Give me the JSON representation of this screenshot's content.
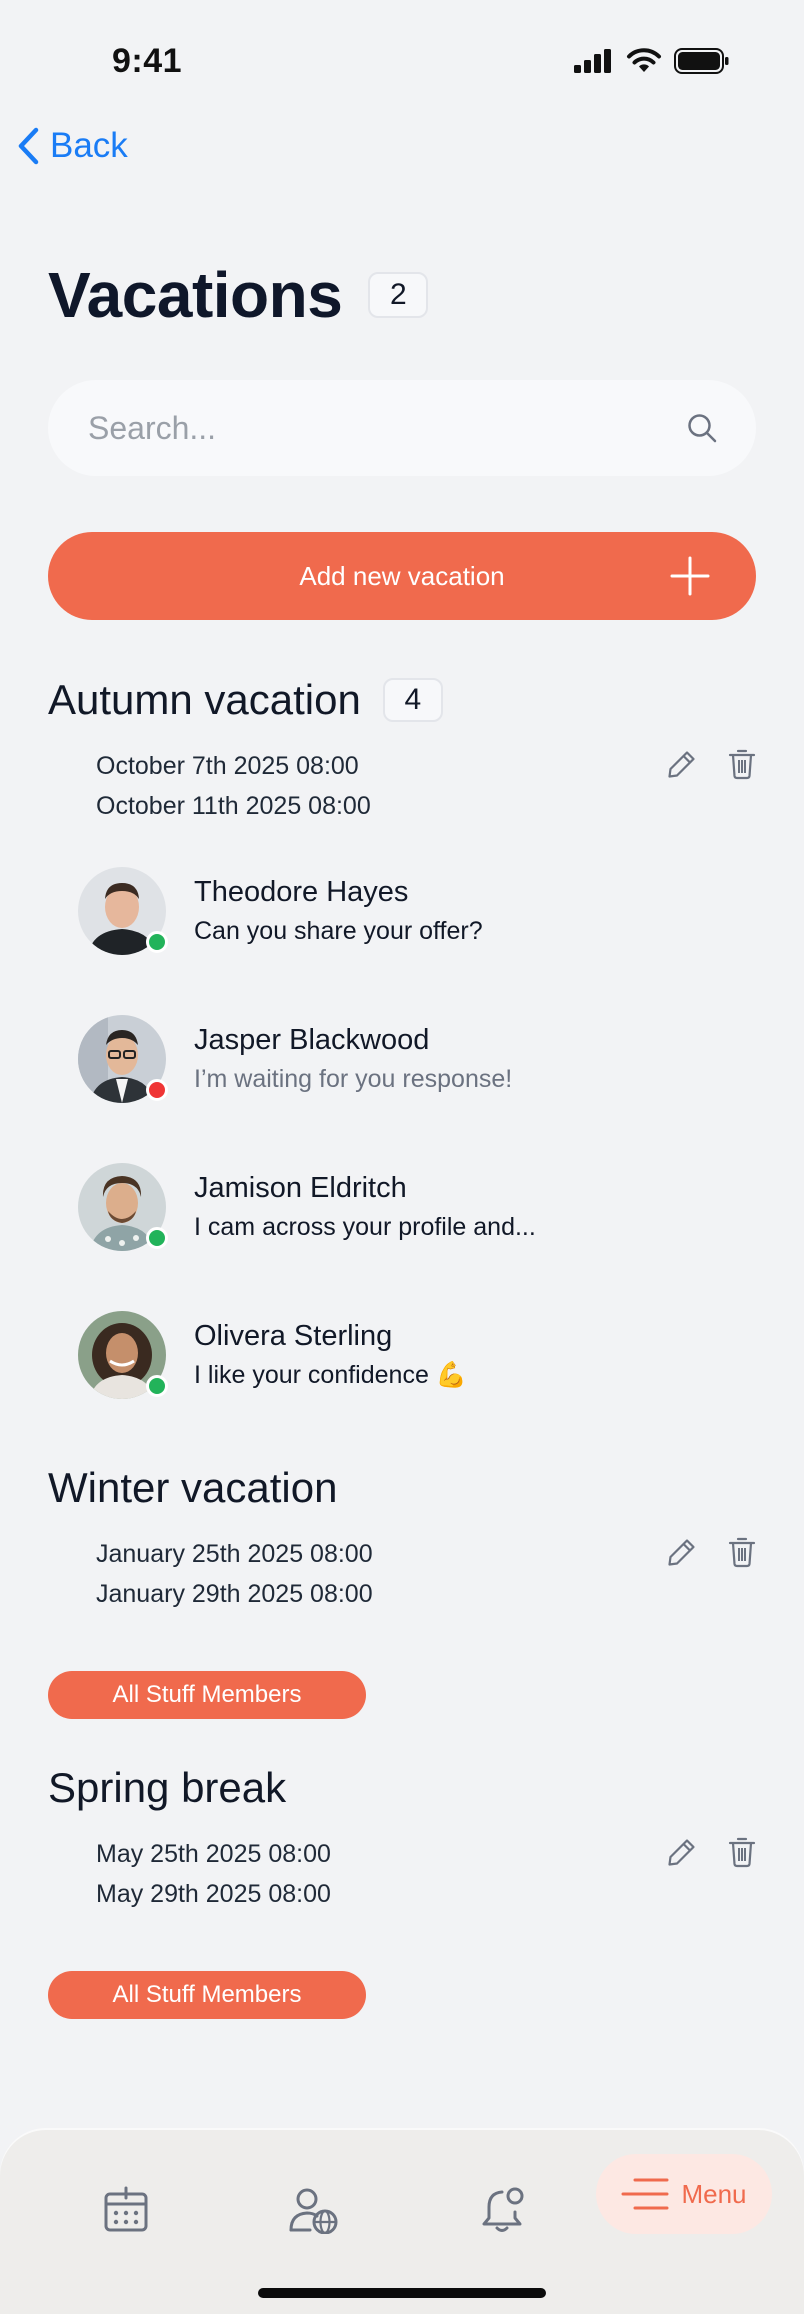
{
  "status_bar": {
    "time": "9:41"
  },
  "nav": {
    "back_label": "Back"
  },
  "page": {
    "title": "Vacations",
    "count": "2"
  },
  "search": {
    "placeholder": "Search..."
  },
  "add_button": {
    "label": "Add new vacation"
  },
  "vacations": [
    {
      "title": "Autumn vacation",
      "count": "4",
      "start": "October 7th 2025 08:00",
      "end": "October 11th 2025 08:00",
      "contacts": [
        {
          "name": "Theodore Hayes",
          "message": "Can you share your offer?",
          "status": "online"
        },
        {
          "name": "Jasper Blackwood",
          "message": "I’m waiting for you response!",
          "status": "busy"
        },
        {
          "name": "Jamison Eldritch",
          "message": "I cam across your profile and...",
          "status": "online"
        },
        {
          "name": "Olivera Sterling",
          "message": "I like your confidence 💪",
          "status": "online"
        }
      ]
    },
    {
      "title": "Winter vacation",
      "start": "January 25th 2025 08:00",
      "end": "January 29th 2025 08:00",
      "members_label": "All Stuff Members"
    },
    {
      "title": "Spring break",
      "start": "May 25th 2025 08:00",
      "end": "May 29th 2025 08:00",
      "members_label": "All Stuff Members"
    }
  ],
  "tab_bar": {
    "menu_label": "Menu",
    "icons": [
      "calendar-icon",
      "user-globe-icon",
      "bell-notification-icon",
      "menu-icon"
    ]
  },
  "colors": {
    "accent": "#f06a4d",
    "link": "#1a7cf5",
    "online": "#22b35a",
    "busy": "#ef3535",
    "background": "#f2f3f5"
  }
}
